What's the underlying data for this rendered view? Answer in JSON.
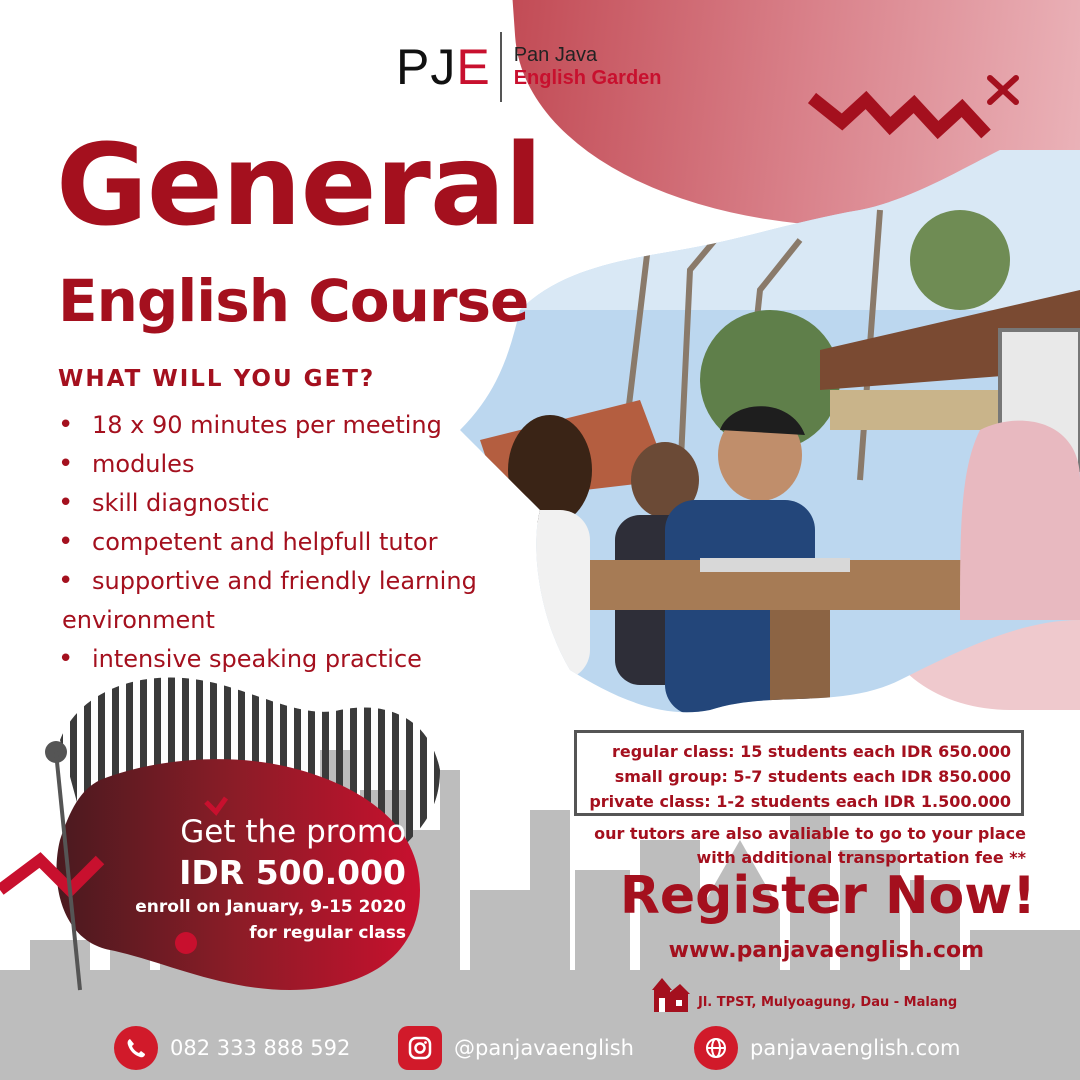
{
  "logo": {
    "initials_pj": "PJ",
    "initials_e": "E",
    "line1": "Pan Java",
    "line2": "English Garden"
  },
  "heading": {
    "title": "General",
    "subtitle": "English Course"
  },
  "benefits": {
    "question": "WHAT WILL YOU GET?",
    "items": [
      "18 x 90 minutes per meeting",
      "modules",
      "skill diagnostic",
      "competent and helpfull tutor",
      "supportive and friendly learning",
      "environment",
      "intensive speaking practice"
    ]
  },
  "prices": {
    "regular": "regular class: 15 students each IDR 650.000",
    "small": "small group: 5-7 students each IDR 850.000",
    "private": "private class: 1-2 students each IDR 1.500.000"
  },
  "tutor_note": {
    "line1": "our tutors are also avaliable to go to your place",
    "line2": "with additional transportation fee **"
  },
  "cta": {
    "register": "Register Now!",
    "website": "www.panjavaenglish.com",
    "address": "Jl. TPST, Mulyoagung, Dau - Malang"
  },
  "promo": {
    "line1": "Get the promo",
    "price": "IDR 500.000",
    "line3": "enroll on January, 9-15 2020",
    "line4": "for regular class"
  },
  "footer": {
    "phone": "082 333 888 592",
    "instagram": "@panjavaenglish",
    "web": "panjavaenglish.com"
  },
  "colors": {
    "brand_red": "#a4101e",
    "accent_red": "#d11a2a",
    "gray": "#b5b5b5",
    "dark_gray": "#555555"
  },
  "icons": [
    "phone-icon",
    "instagram-icon",
    "globe-icon",
    "house-icon"
  ]
}
